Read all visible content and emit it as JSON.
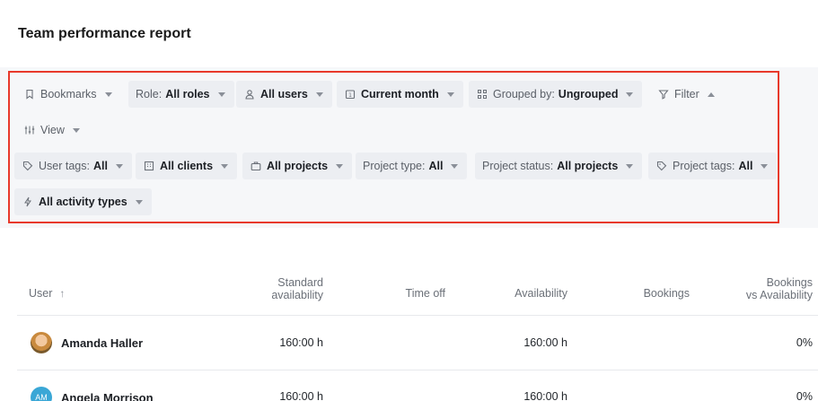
{
  "page": {
    "title": "Team performance report"
  },
  "filters": {
    "bookmarks": {
      "label": "Bookmarks",
      "icon": "bookmark-icon"
    },
    "role": {
      "key": "Role:",
      "value": "All roles"
    },
    "users": {
      "value": "All users",
      "icon": "user-icon"
    },
    "period": {
      "value": "Current month",
      "icon": "calendar-icon"
    },
    "grouped": {
      "key": "Grouped by:",
      "value": "Ungrouped",
      "icon": "group-icon"
    },
    "filter": {
      "label": "Filter",
      "icon": "funnel-icon"
    },
    "view": {
      "label": "View",
      "icon": "sliders-icon"
    },
    "user_tags": {
      "key": "User tags:",
      "value": "All",
      "icon": "tag-icon"
    },
    "clients": {
      "value": "All clients",
      "icon": "building-icon"
    },
    "projects": {
      "value": "All projects",
      "icon": "briefcase-icon"
    },
    "project_type": {
      "key": "Project type:",
      "value": "All"
    },
    "project_status": {
      "key": "Project status:",
      "value": "All projects"
    },
    "project_tags": {
      "key": "Project tags:",
      "value": "All",
      "icon": "tag-icon"
    },
    "activity_types": {
      "value": "All activity types",
      "icon": "bolt-icon"
    }
  },
  "table": {
    "headers": {
      "user": "User",
      "standard_availability_1": "Standard",
      "standard_availability_2": "availability",
      "time_off": "Time off",
      "availability": "Availability",
      "bookings": "Bookings",
      "bookings_vs_1": "Bookings",
      "bookings_vs_2": "vs Availability"
    },
    "rows": [
      {
        "name": "Amanda Haller",
        "avatar": "photo",
        "standard_availability": "160:00 h",
        "time_off": "",
        "availability": "160:00 h",
        "bookings": "",
        "bookings_vs_availability": "0%"
      },
      {
        "name": "Angela Morrison",
        "initials": "AM",
        "standard_availability": "160:00 h",
        "time_off": "",
        "availability": "160:00 h",
        "bookings": "",
        "bookings_vs_availability": "0%"
      }
    ]
  }
}
